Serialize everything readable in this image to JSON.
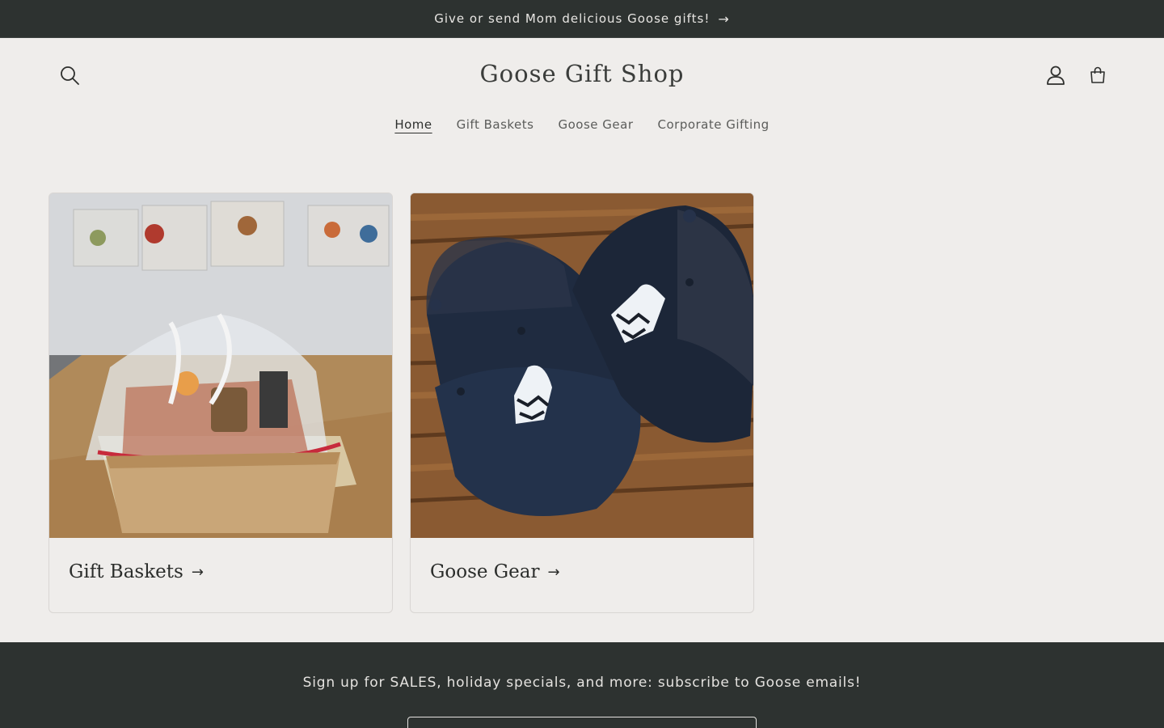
{
  "announcement": {
    "text": "Give or send Mom delicious Goose gifts!",
    "arrow": "→"
  },
  "header": {
    "logo": "Goose Gift Shop",
    "icons": {
      "search": "search-icon",
      "account": "account-icon",
      "cart": "cart-icon"
    }
  },
  "nav": {
    "items": [
      {
        "label": "Home",
        "active": true
      },
      {
        "label": "Gift Baskets",
        "active": false
      },
      {
        "label": "Goose Gear",
        "active": false
      },
      {
        "label": "Corporate Gifting",
        "active": false
      }
    ]
  },
  "collections": [
    {
      "title": "Gift Baskets",
      "arrow": "→"
    },
    {
      "title": "Goose Gear",
      "arrow": "→"
    }
  ],
  "newsletter": {
    "heading": "Sign up for SALES, holiday specials, and more: subscribe to Goose emails!"
  },
  "colors": {
    "dark": "#2d3230",
    "background": "#efedeb"
  }
}
